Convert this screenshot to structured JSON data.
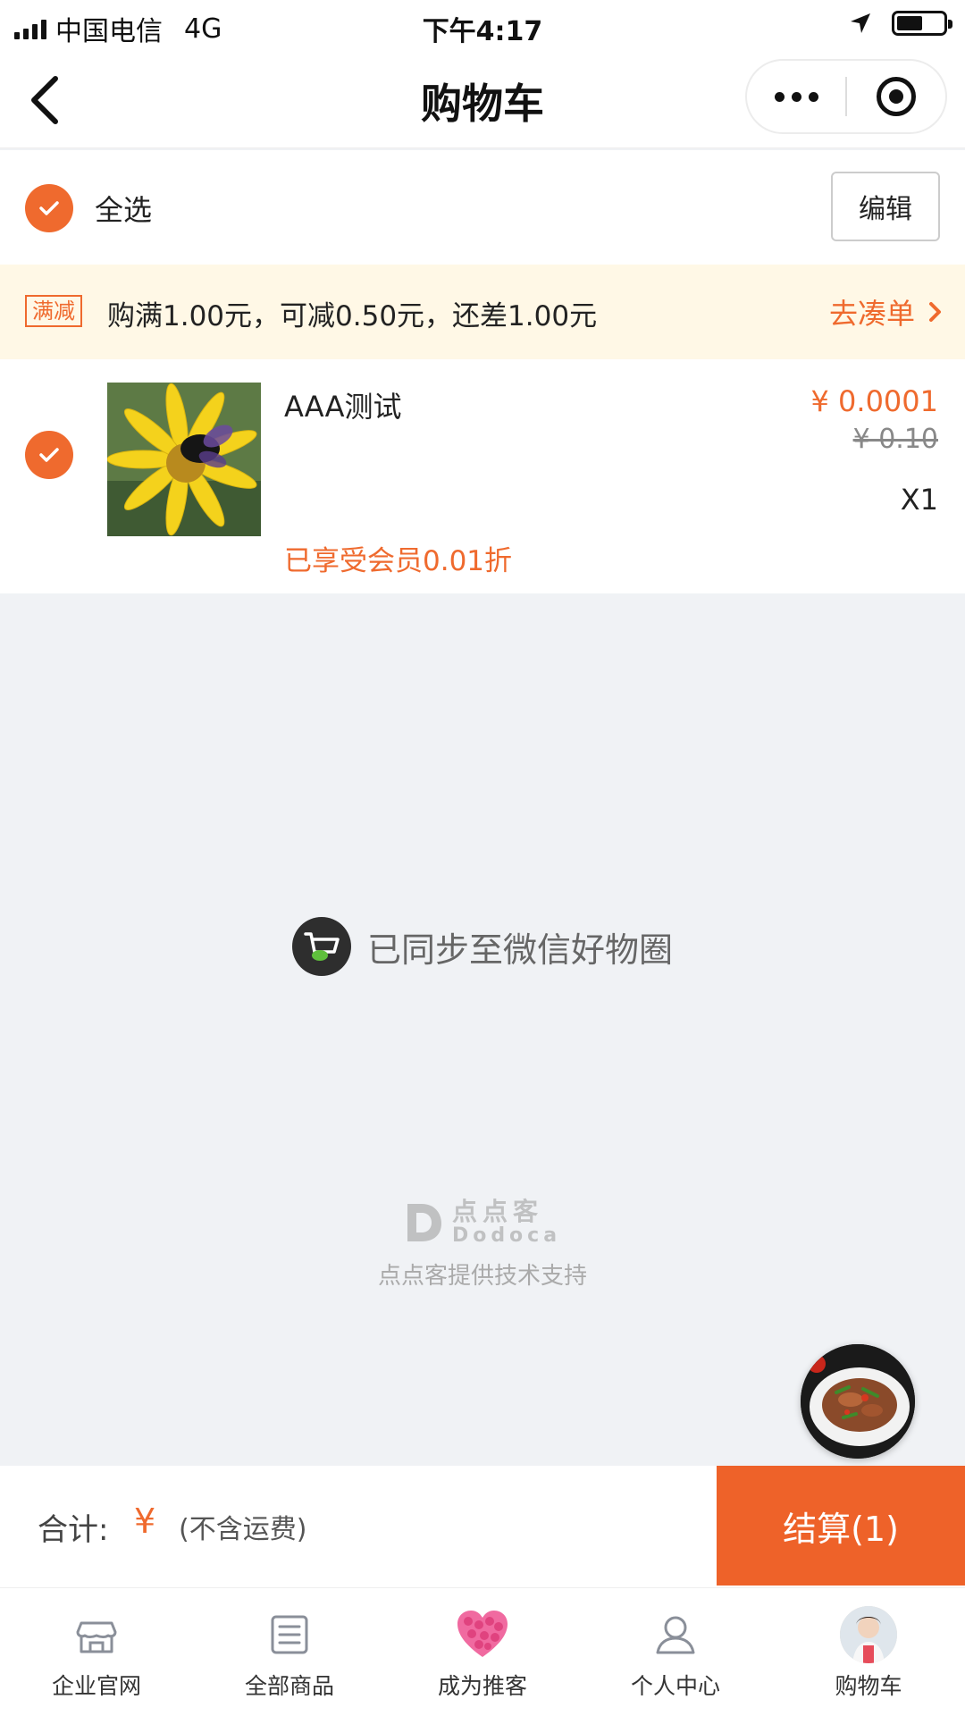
{
  "status_bar": {
    "carrier": "中国电信",
    "network": "4G",
    "time": "下午4:17",
    "battery_level": 0.55
  },
  "nav": {
    "title": "购物车",
    "icons": {
      "back": "chevron-left-icon",
      "more": "more-dots-icon",
      "close": "target-icon"
    }
  },
  "select_all": {
    "label": "全选",
    "checked": true,
    "edit_label": "编辑"
  },
  "promo": {
    "tag": "满减",
    "text": "购满1.00元，可减0.50元，还差1.00元",
    "link_label": "去凑单"
  },
  "cart": {
    "items": [
      {
        "checked": true,
        "name": "AAA测试",
        "price": "¥ 0.0001",
        "original_price": "¥ 0.10",
        "quantity": "X1",
        "member_discount": "已享受会员0.01折",
        "thumbnail": "bee-on-yellow-flower-image"
      }
    ]
  },
  "sync_notice": {
    "text": "已同步至微信好物圈",
    "icon": "wechat-cart-icon"
  },
  "brand": {
    "name_cn": "点点客",
    "name_en": "Dodoca",
    "tagline": "点点客提供技术支持"
  },
  "checkout": {
    "total_label": "合计:",
    "currency": "¥",
    "note": "(不含运费)",
    "button_label": "结算(1)"
  },
  "tabs": [
    {
      "label": "企业官网",
      "icon": "store-icon"
    },
    {
      "label": "全部商品",
      "icon": "list-icon"
    },
    {
      "label": "成为推客",
      "icon": "heart-icon"
    },
    {
      "label": "个人中心",
      "icon": "user-icon"
    },
    {
      "label": "购物车",
      "icon": "avatar-icon"
    }
  ],
  "colors": {
    "accent": "#ef6a2e",
    "promo_bg": "#fff8e6",
    "page_bg": "#f0f2f5"
  }
}
